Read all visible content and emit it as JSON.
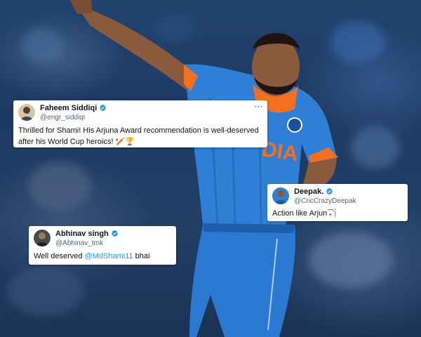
{
  "colors": {
    "jersey": "#2f7fd6",
    "jersey_dark": "#1c5ca8",
    "accent_orange": "#f36f21",
    "verified_blue": "#1d9bf0",
    "mention_blue": "#1d9bf0",
    "card_bg": "#ffffff"
  },
  "jersey_text": "DIA",
  "tweets": [
    {
      "name": "Faheem Siddiqi",
      "handle": "@engr_siddiqi",
      "verified": true,
      "more_icon": "⋯",
      "text": "Thrilled for Shami! His Arjuna Award recommendation is well-deserved after his World Cup heroics! 🏏🏆"
    },
    {
      "name": "Deepak.",
      "handle": "@CricCrazyDeepak",
      "verified": true,
      "text": "Action like Arjun🏹"
    },
    {
      "name": "Abhinav singh",
      "handle": "@Abhinav_tmk",
      "verified": true,
      "text_before": "Well deserved ",
      "mention": "@MdShami11",
      "text_after": " bhai"
    }
  ]
}
